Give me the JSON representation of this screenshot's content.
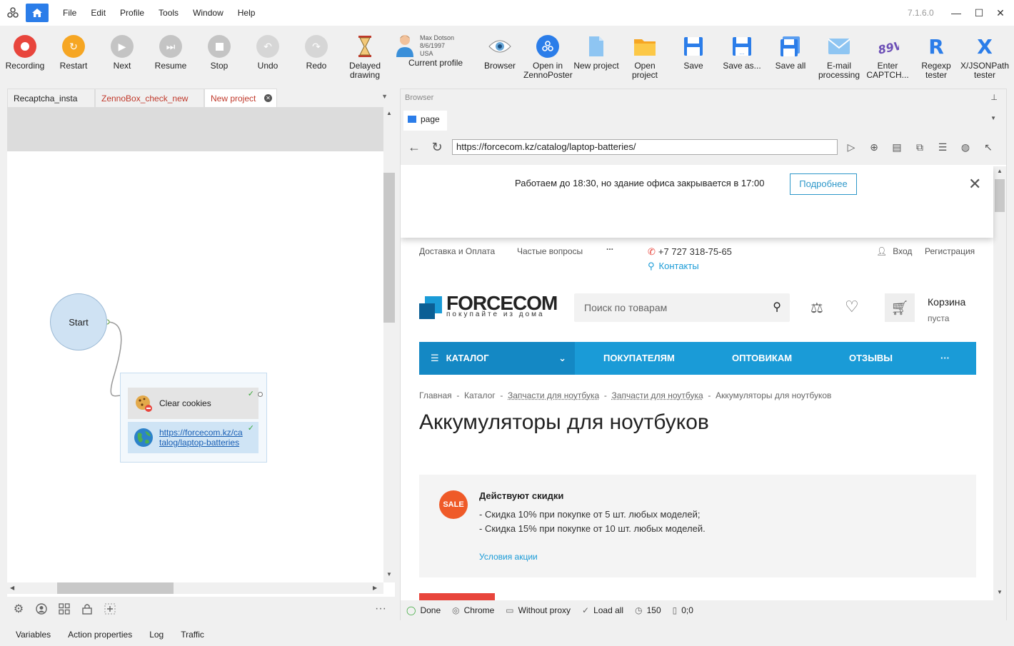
{
  "menu": [
    "File",
    "Edit",
    "Profile",
    "Tools",
    "Window",
    "Help"
  ],
  "version": "7.1.6.0",
  "toolbar": {
    "recording": "Recording",
    "restart": "Restart",
    "next": "Next",
    "resume": "Resume",
    "stop": "Stop",
    "undo": "Undo",
    "redo": "Redo",
    "delayed_1": "Delayed",
    "delayed_2": "drawing",
    "profile_name": "Max Dotson",
    "profile_date": "8/6/1997",
    "profile_country": "USA",
    "current_profile": "Current profile",
    "browser": "Browser",
    "open_in_1": "Open in",
    "open_in_2": "ZennoPoster",
    "new_project": "New project",
    "open_project": "Open project",
    "save": "Save",
    "save_as": "Save as...",
    "save_all": "Save all",
    "email_1": "E-mail",
    "email_2": "processing",
    "captcha_1": "Enter",
    "captcha_2": "CAPTCH...",
    "regexp": "Regexp tester",
    "xjson_1": "X/JSONPath",
    "xjson_2": "tester"
  },
  "project_tabs": [
    "Recaptcha_insta",
    "ZennoBox_check_new",
    "New project"
  ],
  "nodes": {
    "start": "Start",
    "clear_cookies": "Clear cookies",
    "url_1": "https://forcecom.kz/ca",
    "url_2": "talog/laptop-batteries"
  },
  "bottom_tabs": [
    "Variables",
    "Action properties",
    "Log",
    "Traffic"
  ],
  "browser": {
    "title": "Browser",
    "tab": "page",
    "url": "https://forcecom.kz/catalog/laptop-batteries/",
    "status": {
      "done": "Done",
      "engine": "Chrome",
      "proxy": "Without proxy",
      "load": "Load all",
      "timeout": "150",
      "coords": "0;0"
    }
  },
  "webpage": {
    "banner_text": "Работаем до 18:30, но здание офиса закрывается в 17:00",
    "banner_button": "Подробнее",
    "topnav": [
      "Доставка и Оплата",
      "Частые вопросы",
      "...",
      "+7 727 318-75-65",
      "Контакты",
      "Вход",
      "Регистрация"
    ],
    "logo_main": "FORCECOM",
    "logo_sub": "покупайте из дома",
    "search_placeholder": "Поиск по товарам",
    "cart_title": "Корзина",
    "cart_status": "пуста",
    "nav": [
      "КАТАЛОГ",
      "ПОКУПАТЕЛЯМ",
      "ОПТОВИКАМ",
      "ОТЗЫВЫ",
      "···"
    ],
    "crumbs": [
      "Главная",
      "Каталог",
      "Запчасти для ноутбука",
      "Запчасти для ноутбука",
      "Аккумуляторы для ноутбуков"
    ],
    "heading": "Аккумуляторы для ноутбуков",
    "sale_badge": "SALE",
    "sale_title": "Действуют скидки",
    "sale_line1": "- Скидка 10% при покупке от 5 шт. любых моделей;",
    "sale_line2": "- Скидка 15% при покупке от 10 шт. любых моделей.",
    "sale_link": "Условия акции"
  },
  "colors": {
    "accent": "#2b7de9",
    "record": "#e8453c",
    "restart": "#f6a623",
    "brand": "#1a9bd7",
    "sale": "#ef5a28"
  }
}
